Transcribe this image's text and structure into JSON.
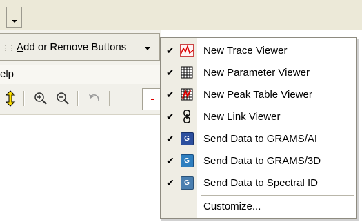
{
  "toolbar": {
    "add_remove": {
      "prefix": "",
      "underlined": "A",
      "rest": "dd or Remove Buttons"
    },
    "help_label": "elp"
  },
  "menu": {
    "items": [
      {
        "label_before": "New Trace Viewer",
        "underline": "",
        "label_after": "",
        "icon": "trace-viewer-icon",
        "checked": true
      },
      {
        "label_before": "New Parameter Viewer",
        "underline": "",
        "label_after": "",
        "icon": "parameter-viewer-icon",
        "checked": true
      },
      {
        "label_before": "New Peak Table Viewer",
        "underline": "",
        "label_after": "",
        "icon": "peak-table-viewer-icon",
        "checked": true
      },
      {
        "label_before": "New Link Viewer",
        "underline": "",
        "label_after": "",
        "icon": "link-viewer-icon",
        "checked": true
      },
      {
        "label_before": "Send Data to ",
        "underline": "G",
        "label_after": "RAMS/AI",
        "icon": "grams-ai-icon",
        "checked": true
      },
      {
        "label_before": "Send Data to GRAMS/3",
        "underline": "D",
        "label_after": "",
        "icon": "grams-3d-icon",
        "checked": true
      },
      {
        "label_before": "Send Data to ",
        "underline": "S",
        "label_after": "pectral ID",
        "icon": "spectral-id-icon",
        "checked": true
      }
    ],
    "customize_label": "Customize...",
    "check_glyph": "✔"
  },
  "icons": {
    "grams_letter": "G",
    "grams3d_letter": "G",
    "spectral_letter": "G"
  }
}
